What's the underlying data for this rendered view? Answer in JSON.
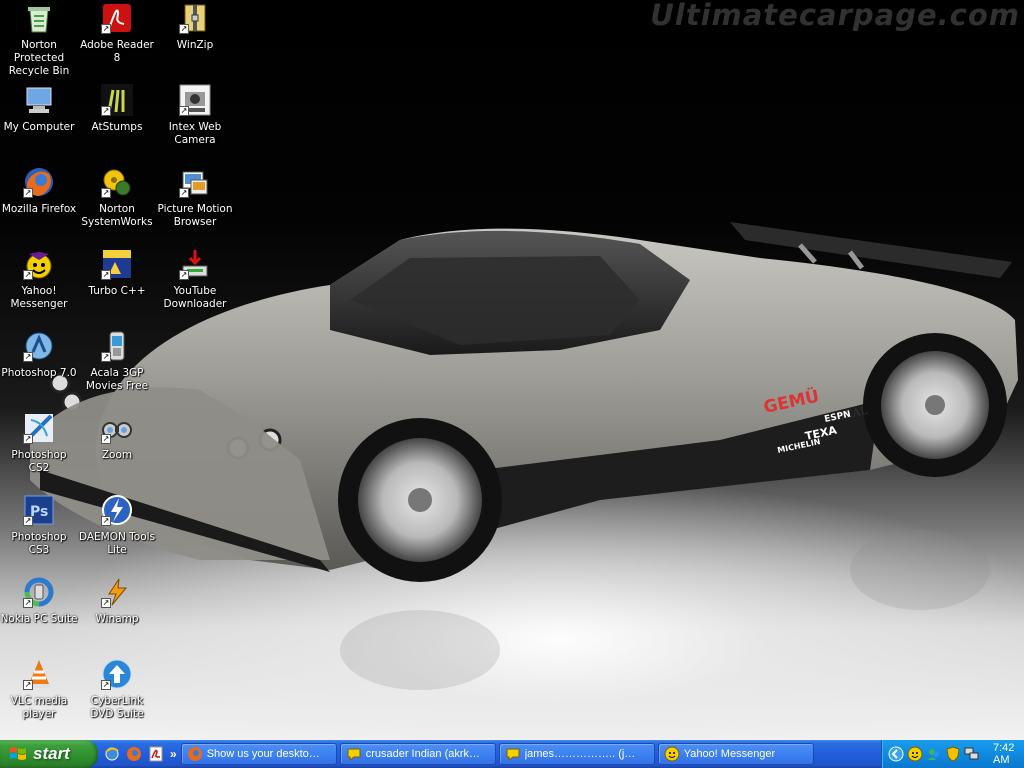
{
  "wallpaper": {
    "watermark": "Ultimatecarpage.com",
    "car_sponsors": [
      "GEMÜ",
      "SEAL",
      "TEXA",
      "ESPN",
      "MICHELIN"
    ]
  },
  "desktop_icons": [
    {
      "label": "Norton Protected Recycle Bin",
      "icon": "recycle-bin-icon"
    },
    {
      "label": "Adobe Reader 8",
      "icon": "adobe-reader-icon"
    },
    {
      "label": "WinZip",
      "icon": "winzip-icon"
    },
    {
      "label": "My Computer",
      "icon": "my-computer-icon"
    },
    {
      "label": "AtStumps",
      "icon": "atstumps-icon"
    },
    {
      "label": "Intex Web Camera",
      "icon": "webcam-icon"
    },
    {
      "label": "Mozilla Firefox",
      "icon": "firefox-icon"
    },
    {
      "label": "Norton SystemWorks",
      "icon": "norton-systemworks-icon"
    },
    {
      "label": "Picture Motion Browser",
      "icon": "picture-motion-browser-icon"
    },
    {
      "label": "Yahoo! Messenger",
      "icon": "yahoo-messenger-icon"
    },
    {
      "label": "Turbo C++",
      "icon": "turbo-cpp-icon"
    },
    {
      "label": "YouTube Downloader",
      "icon": "youtube-downloader-icon"
    },
    {
      "label": "Photoshop 7.0",
      "icon": "photoshop7-icon"
    },
    {
      "label": "Acala 3GP Movies Free",
      "icon": "acala-3gp-icon"
    },
    {
      "label": "Photoshop CS2",
      "icon": "photoshop-cs2-icon"
    },
    {
      "label": "Zoom",
      "icon": "zoom-icon"
    },
    {
      "label": "Photoshop CS3",
      "icon": "photoshop-cs3-icon"
    },
    {
      "label": "DAEMON Tools Lite",
      "icon": "daemon-tools-icon"
    },
    {
      "label": "Nokia PC Suite",
      "icon": "nokia-pc-suite-icon"
    },
    {
      "label": "Winamp",
      "icon": "winamp-icon"
    },
    {
      "label": "VLC media player",
      "icon": "vlc-icon"
    },
    {
      "label": "CyberLink DVD Suite",
      "icon": "cyberlink-dvd-icon"
    }
  ],
  "taskbar": {
    "start_label": "start",
    "quick_launch": [
      "ie-icon",
      "firefox-icon",
      "acrobat-icon"
    ],
    "quick_launch_more": "»",
    "tasks": [
      {
        "label": "Show us your deskto…",
        "icon": "firefox-icon"
      },
      {
        "label": "crusader Indian (akrk…",
        "icon": "chat-icon"
      },
      {
        "label": "james…………….. (j…",
        "icon": "chat-icon"
      },
      {
        "label": "Yahoo! Messenger",
        "icon": "yahoo-icon"
      }
    ],
    "tray_icons": [
      "expand-tray-icon",
      "yahoo-smiley-icon",
      "messenger-icon",
      "shield-icon",
      "network-icon"
    ],
    "clock": "7:42 AM"
  }
}
